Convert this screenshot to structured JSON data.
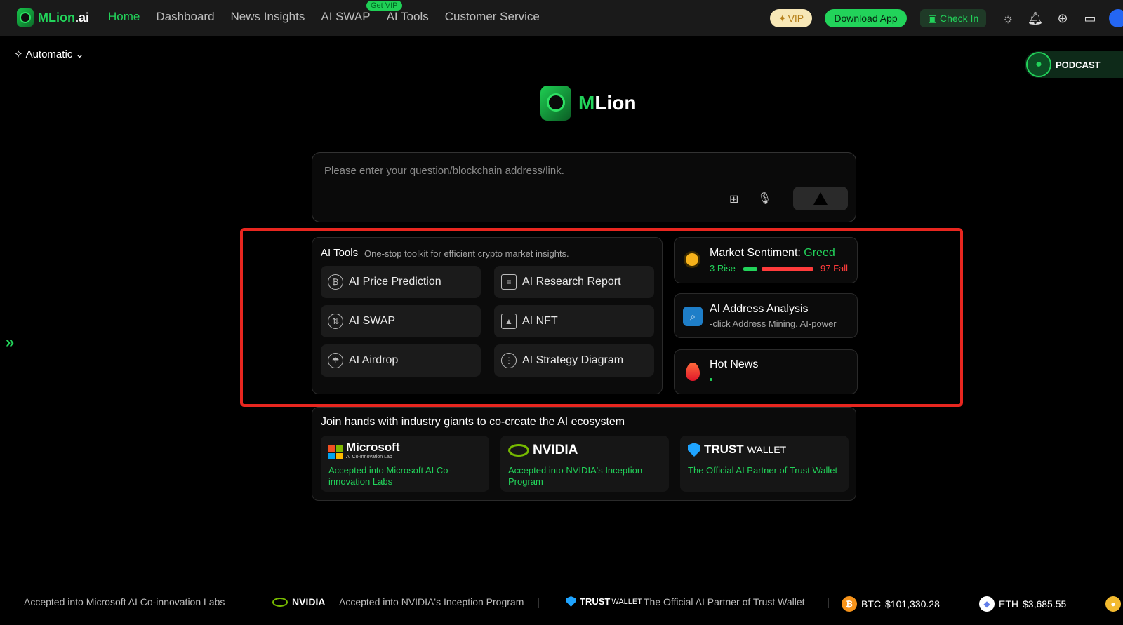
{
  "nav": {
    "logo_main": "MLion",
    "logo_suffix": ".ai",
    "links": [
      "Home",
      "Dashboard",
      "News Insights",
      "AI SWAP",
      "AI Tools",
      "Customer Service"
    ],
    "getvip_badge": "Get VIP",
    "vip_label": "VIP",
    "download_label": "Download App",
    "checkin_label": "Check In"
  },
  "mode": {
    "label": "Automatic"
  },
  "podcast": {
    "label": "PODCAST"
  },
  "brand": {
    "name_main": "M",
    "name_rest": "Lion"
  },
  "search": {
    "placeholder": "Please enter your question/blockchain address/link."
  },
  "tools": {
    "title": "AI Tools",
    "subtitle": "One-stop toolkit for efficient crypto market insights.",
    "items": [
      {
        "label": "AI Price Prediction",
        "icon": "bitcoin-icon"
      },
      {
        "label": "AI Research Report",
        "icon": "document-icon"
      },
      {
        "label": "AI SWAP",
        "icon": "swap-icon"
      },
      {
        "label": "AI NFT",
        "icon": "image-icon"
      },
      {
        "label": "AI Airdrop",
        "icon": "parachute-icon"
      },
      {
        "label": "AI Strategy Diagram",
        "icon": "strategy-icon"
      }
    ]
  },
  "sentiment": {
    "label": "Market Sentiment: ",
    "value": "Greed",
    "rise": "3 Rise",
    "fall": "97 Fall",
    "rise_fraction": 0.2
  },
  "address_analysis": {
    "title": "AI Address Analysis",
    "subtitle": "-click Address Mining. AI-power"
  },
  "hot_news": {
    "title": "Hot News"
  },
  "partners": {
    "title": "Join hands with industry giants to co-create the AI ecosystem",
    "items": [
      {
        "name": "Microsoft",
        "sub": "AI Co-Innovation Lab",
        "desc": "Accepted into Microsoft AI Co-innovation Labs"
      },
      {
        "name": "NVIDIA",
        "desc": "Accepted into NVIDIA's Inception Program"
      },
      {
        "name": "TRUST",
        "name_suffix": "WALLET",
        "desc": "The Official AI Partner of Trust Wallet"
      }
    ]
  },
  "ticker": {
    "items": [
      "Accepted into Microsoft AI Co-innovation Labs",
      "NVIDIA",
      "Accepted into NVIDIA's Inception Program",
      "TRUST",
      "WALLET",
      "The Official AI Partner of Trust Wallet"
    ],
    "btc": {
      "symbol": "BTC",
      "price": "$101,330.28"
    },
    "eth": {
      "symbol": "ETH",
      "price": "$3,685.55"
    }
  },
  "colors": {
    "accent": "#22d35a",
    "fall": "#ff3b3b",
    "highlight": "#e8261f"
  }
}
